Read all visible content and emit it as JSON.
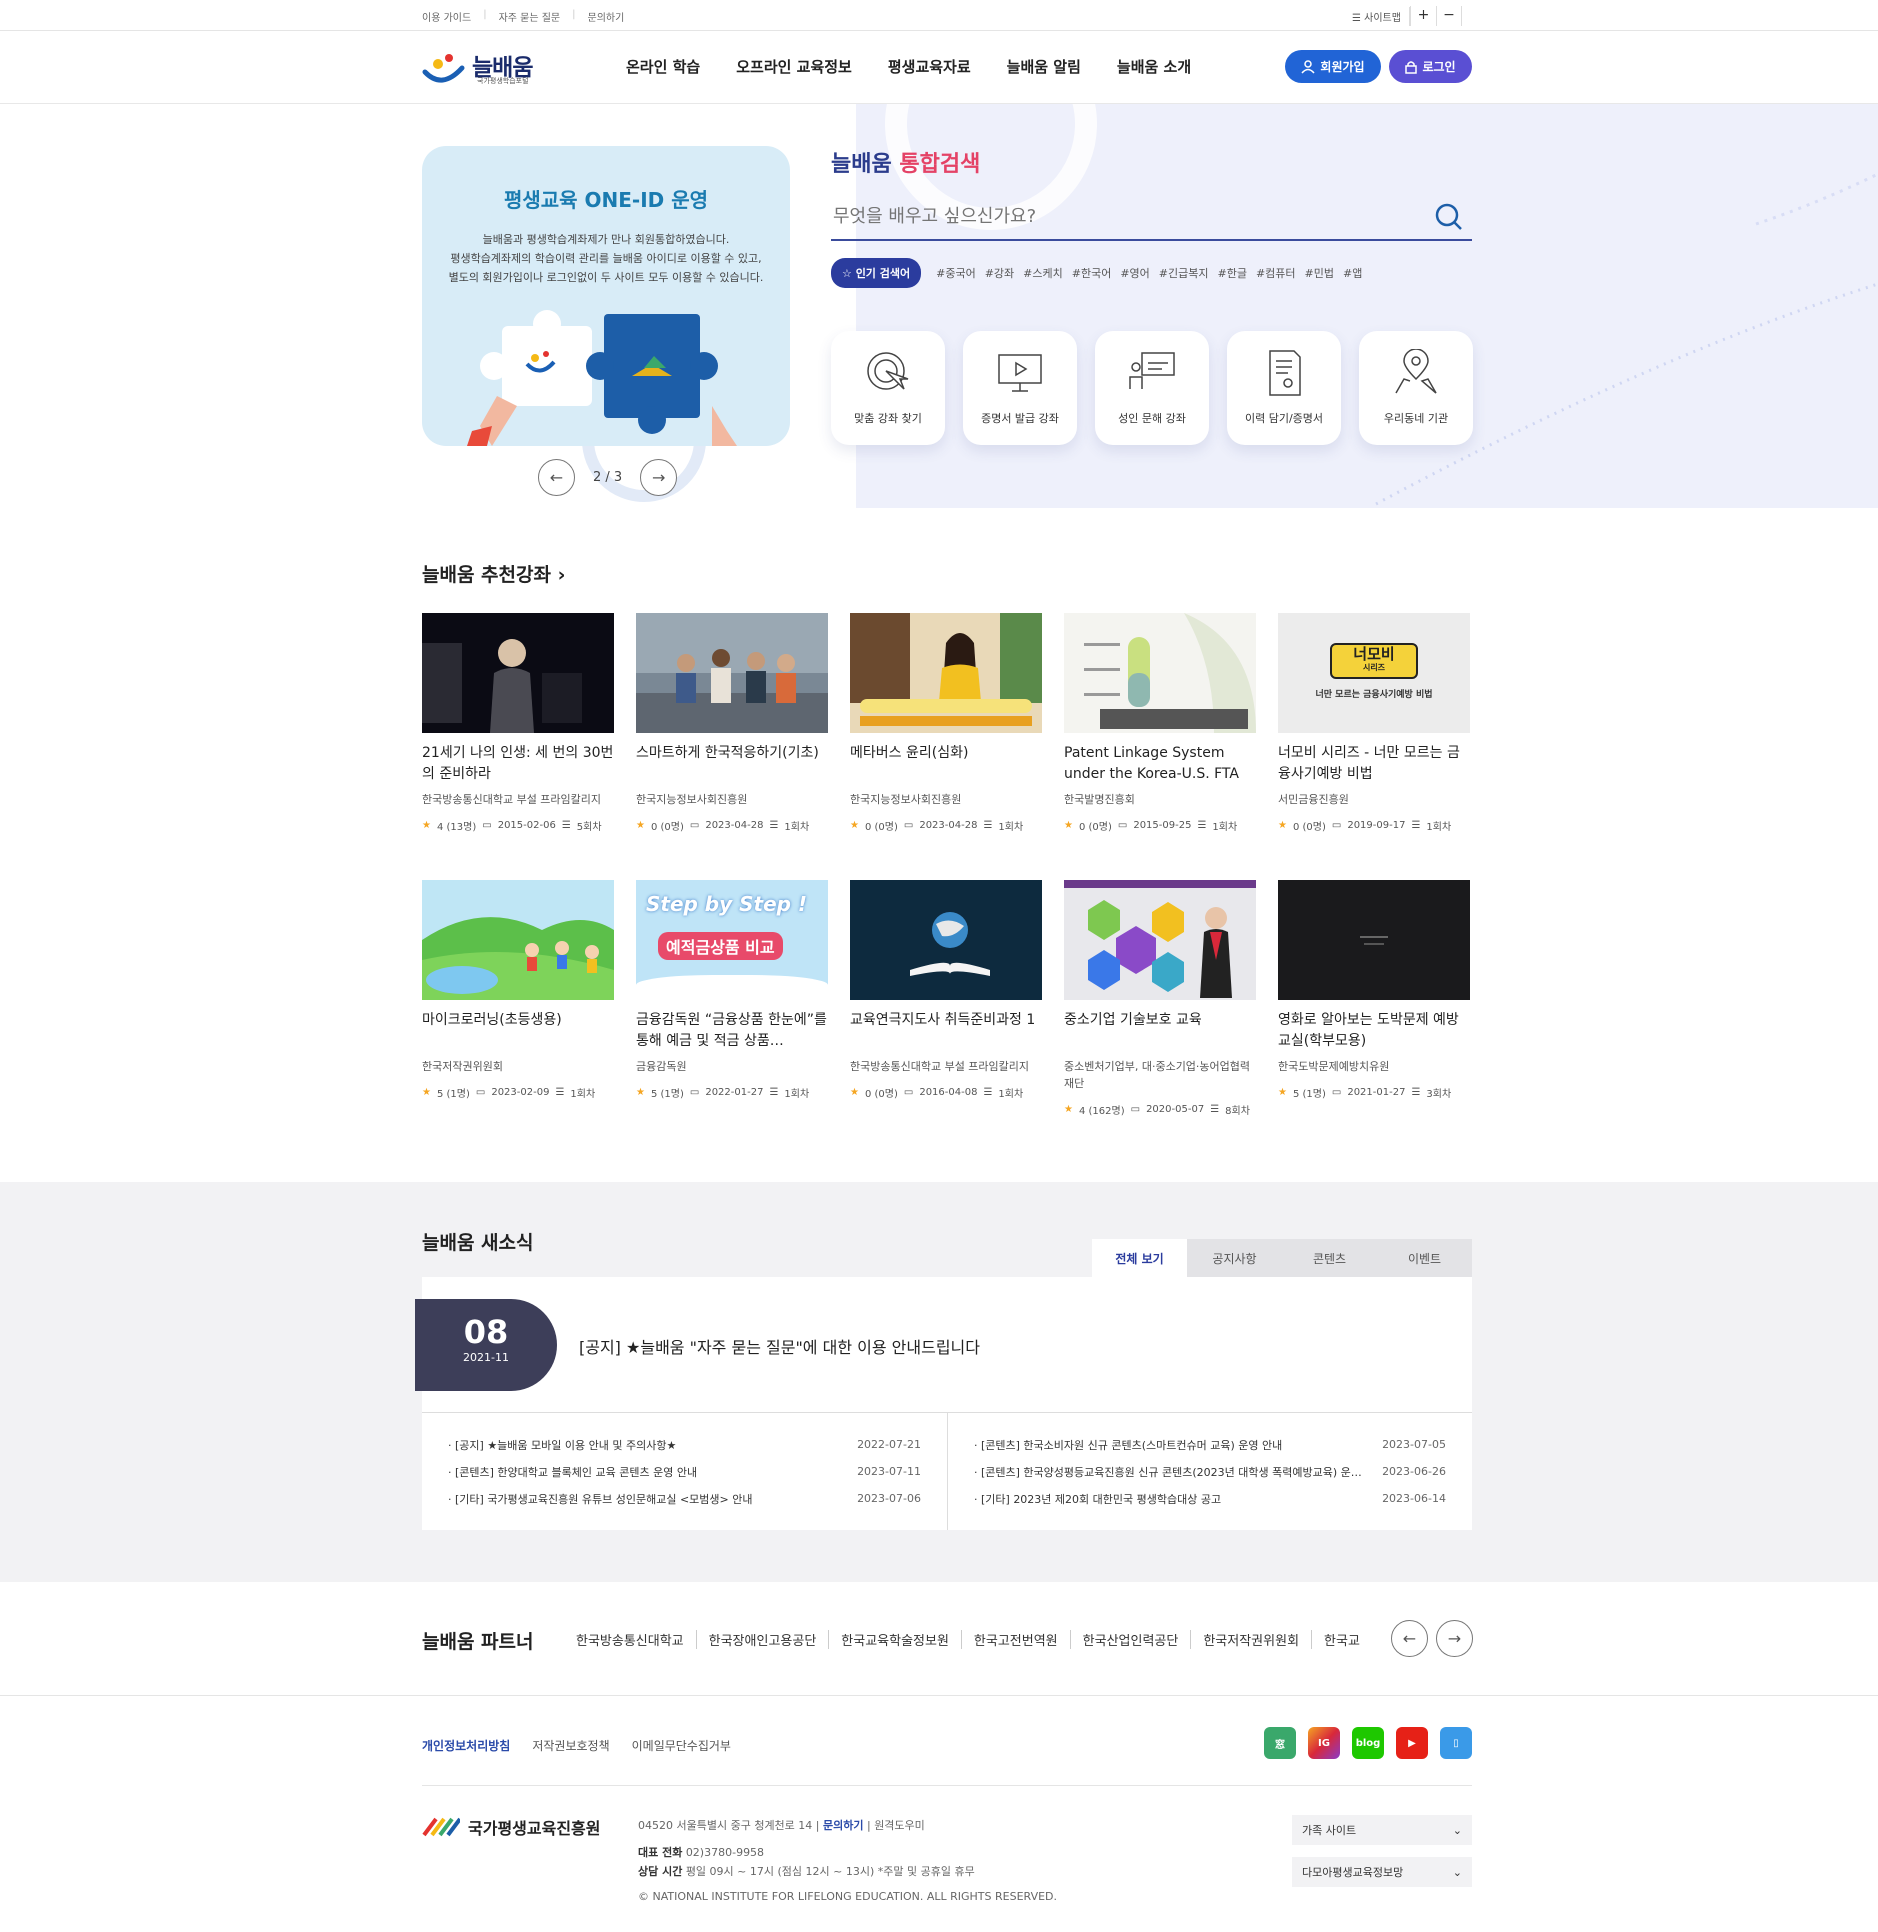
{
  "util": {
    "links": [
      "이용 가이드",
      "자주 묻는 질문",
      "문의하기"
    ],
    "sitemap": "☰ 사이트맵",
    "zoom_in": "+",
    "zoom_out": "−"
  },
  "header": {
    "logo_text": "늘배움",
    "logo_sub": "국가평생학습포털",
    "nav": [
      "온라인 학습",
      "오프라인 교육정보",
      "평생교육자료",
      "늘배움 알림",
      "늘배움 소개"
    ],
    "join_label": "회원가입",
    "login_label": "로그인"
  },
  "banner": {
    "title": "평생교육 ONE-ID 운영",
    "lines": [
      "늘배움과 평생학습계좌제가 만나 회원통합하였습니다.",
      "평생학습계좌제의 학습이력 관리를 늘배움 아이디로 이용할 수 있고,",
      "별도의 회원가입이나 로그인없이 두 사이트 모두 이용할 수 있습니다."
    ],
    "pager": "2 / 3"
  },
  "search": {
    "title_a": "늘배움",
    "title_b": "통합검색",
    "placeholder": "무엇을 배우고 싶으신가요?",
    "popular_label": "☆ 인기 검색어",
    "tags": [
      "#중국어",
      "#강좌",
      "#스케치",
      "#한국어",
      "#영어",
      "#긴급복지",
      "#한글",
      "#컴퓨터",
      "#민법",
      "#앱"
    ]
  },
  "quick": [
    "맞춤 강좌 찾기",
    "증명서 발급 강좌",
    "성인 문해 강좌",
    "이력 담기/증명서",
    "우리동네 기관"
  ],
  "recommend": {
    "title": "늘배움 추천강좌 ›",
    "courses": [
      {
        "title": "21세기 나의 인생: 세 번의 30번의 준비하라",
        "org": "한국방송통신대학교 부설 프라임칼리지",
        "rating": "4 (13명)",
        "date": "2015-02-06",
        "sessions": "5회차"
      },
      {
        "title": "스마트하게 한국적응하기(기초)",
        "org": "한국지능정보사회진흥원",
        "rating": "0 (0명)",
        "date": "2023-04-28",
        "sessions": "1회차"
      },
      {
        "title": "메타버스 윤리(심화)",
        "org": "한국지능정보사회진흥원",
        "rating": "0 (0명)",
        "date": "2023-04-28",
        "sessions": "1회차"
      },
      {
        "title": "Patent Linkage System under the Korea-U.S. FTA",
        "org": "한국발명진흥회",
        "rating": "0 (0명)",
        "date": "2015-09-25",
        "sessions": "1회차"
      },
      {
        "title": "너모비 시리즈 - 너만 모르는 금융사기예방 비법",
        "org": "서민금융진흥원",
        "rating": "0 (0명)",
        "date": "2019-09-17",
        "sessions": "1회차"
      },
      {
        "title": "마이크로러닝(초등생용)",
        "org": "한국저작권위원회",
        "rating": "5 (1명)",
        "date": "2023-02-09",
        "sessions": "1회차"
      },
      {
        "title": "금융감독원 “금융상품 한눈에”를 통해 예금 및 적금 상품…",
        "org": "금융감독원",
        "rating": "5 (1명)",
        "date": "2022-01-27",
        "sessions": "1회차"
      },
      {
        "title": "교육연극지도사 취득준비과정 1",
        "org": "한국방송통신대학교 부설 프라임칼리지",
        "rating": "0 (0명)",
        "date": "2016-04-08",
        "sessions": "1회차"
      },
      {
        "title": "중소기업 기술보호 교육",
        "org": "중소벤처기업부, 대·중소기업·농어업협력재단",
        "rating": "4 (162명)",
        "date": "2020-05-07",
        "sessions": "8회차"
      },
      {
        "title": "영화로 알아보는 도박문제 예방교실(학부모용)",
        "org": "한국도박문제예방치유원",
        "rating": "5 (1명)",
        "date": "2021-01-27",
        "sessions": "3회차"
      }
    ],
    "thumb_texts": {
      "t5_a": "너모비",
      "t5_b": "시리즈",
      "t5_c": "너만 모르는 금융사기예방 비법",
      "t7_a": "Step by Step !",
      "t7_b": "예적금상품 비교"
    }
  },
  "news": {
    "title": "늘배움 새소식",
    "tabs": [
      "전체 보기",
      "공지사항",
      "콘텐츠",
      "이벤트"
    ],
    "badge_day": "08",
    "badge_month": "2021-11",
    "headline": "[공지] ★늘배움 \"자주 묻는 질문\"에 대한 이용 안내드립니다",
    "left": [
      {
        "title": "· [공지] ★늘배움 모바일 이용 안내 및 주의사항★",
        "date": "2022-07-21"
      },
      {
        "title": "· [콘텐츠] 한양대학교 블록체인 교육 콘텐츠 운영 안내",
        "date": "2023-07-11"
      },
      {
        "title": "· [기타] 국가평생교육진흥원 유튜브 성인문해교실 <모범생> 안내",
        "date": "2023-07-06"
      }
    ],
    "right": [
      {
        "title": "· [콘텐츠] 한국소비자원 신규 콘텐츠(스마트컨슈머 교육) 운영 안내",
        "date": "2023-07-05"
      },
      {
        "title": "· [콘텐츠] 한국양성평등교육진흥원 신규 콘텐츠(2023년 대학생 폭력예방교육) 운…",
        "date": "2023-06-26"
      },
      {
        "title": "· [기타] 2023년 제20회 대한민국 평생학습대상 공고",
        "date": "2023-06-14"
      }
    ]
  },
  "partners": {
    "title": "늘배움 파트너",
    "list": [
      "한국방송통신대학교",
      "한국장애인고용공단",
      "한국교육학술정보원",
      "한국고전번역원",
      "한국산업인력공단",
      "한국저작권위원회",
      "한국교"
    ]
  },
  "footer": {
    "links": [
      "개인정보처리방침",
      "저작권보호정책",
      "이메일무단수집거부"
    ],
    "sns": [
      "窓",
      "IG",
      "blog",
      "▶",
      "▯"
    ],
    "org": "국가평생교육진흥원",
    "address": "04520 서울특별시 중구 청계천로 14",
    "contact": "문의하기",
    "remote": "원격도우미",
    "phone_label": "대표 전화",
    "phone": "02)3780-9958",
    "hours_label": "상담 시간",
    "hours": "평일 09시 ~ 17시 (점심 12시 ~ 13시) *주말 및 공휴일 휴무",
    "copyright": "© NATIONAL INSTITUTE FOR LIFELONG EDUCATION. ALL RIGHTS RESERVED.",
    "family_site": "가족 사이트",
    "damoa": "다모아평생교육정보망"
  }
}
